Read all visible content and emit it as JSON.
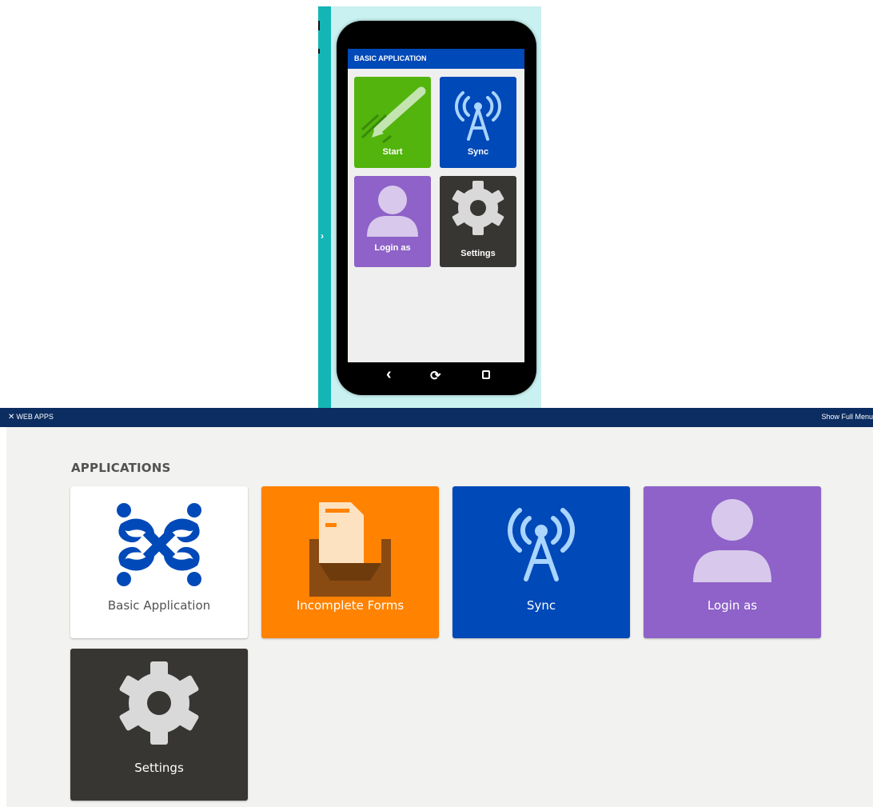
{
  "phone_preview": {
    "app_title": "BASIC APPLICATION",
    "expand_icon": "chevron-right-icon",
    "tiles": [
      {
        "label": "Start",
        "icon": "pencil-icon",
        "color": "#52b40c"
      },
      {
        "label": "Sync",
        "icon": "antenna-icon",
        "color": "#0049b8"
      },
      {
        "label": "Login as",
        "icon": "user-icon",
        "color": "#8e62c8"
      },
      {
        "label": "Settings",
        "icon": "gear-icon",
        "color": "#383633"
      }
    ],
    "nav": [
      "back-icon",
      "refresh-icon",
      "square-icon"
    ]
  },
  "topbar": {
    "brand": "WEB APPS",
    "brand_icon": "web-apps-logo-icon",
    "menu_link": "Show Full Menu",
    "color": "#0c2d61"
  },
  "applications": {
    "heading": "APPLICATIONS",
    "tiles": [
      {
        "label": "Basic Application",
        "icon": "commcare-logo-icon",
        "color": "#ffffff"
      },
      {
        "label": "Incomplete Forms",
        "icon": "inbox-forms-icon",
        "color": "#ff8200"
      },
      {
        "label": "Sync",
        "icon": "antenna-icon",
        "color": "#0049b8"
      },
      {
        "label": "Login as",
        "icon": "user-icon",
        "color": "#8e62c8"
      },
      {
        "label": "Settings",
        "icon": "gear-icon",
        "color": "#383633"
      }
    ]
  }
}
